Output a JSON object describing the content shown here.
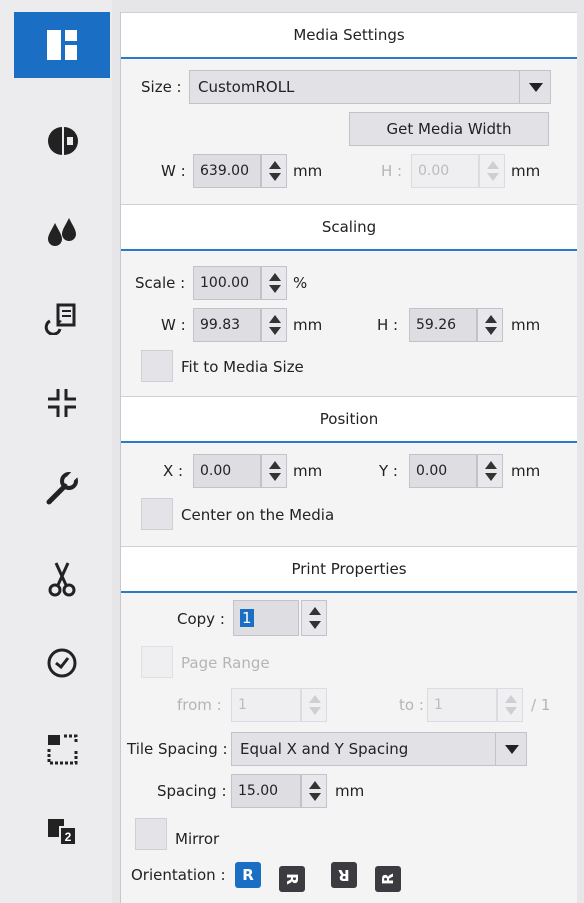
{
  "sidebar": {
    "items": [
      {
        "icon": "layout-icon",
        "active": true
      },
      {
        "icon": "color-half-icon",
        "active": false
      },
      {
        "icon": "ink-drops-icon",
        "active": false
      },
      {
        "icon": "color-sync-icon",
        "active": false
      },
      {
        "icon": "crop-marks-icon",
        "active": false
      },
      {
        "icon": "wrench-icon",
        "active": false
      },
      {
        "icon": "scissors-icon",
        "active": false
      },
      {
        "icon": "clock-icon",
        "active": false
      },
      {
        "icon": "frame-select-icon",
        "active": false
      },
      {
        "icon": "page-order-icon",
        "active": false
      }
    ],
    "accent": "#1a6fc4"
  },
  "media_settings": {
    "title": "Media Settings",
    "size_label": "Size :",
    "size_value": "CustomROLL",
    "get_width_button": "Get Media Width",
    "w_label": "W :",
    "w_value": "639.00",
    "w_unit": "mm",
    "h_label": "H :",
    "h_value": "0.00",
    "h_unit": "mm"
  },
  "scaling": {
    "title": "Scaling",
    "scale_label": "Scale :",
    "scale_value": "100.00",
    "scale_unit": "%",
    "w_label": "W :",
    "w_value": "99.83",
    "w_unit": "mm",
    "h_label": "H :",
    "h_value": "59.26",
    "h_unit": "mm",
    "fit_label": "Fit to Media Size"
  },
  "position": {
    "title": "Position",
    "x_label": "X :",
    "x_value": "0.00",
    "x_unit": "mm",
    "y_label": "Y :",
    "y_value": "0.00",
    "y_unit": "mm",
    "center_label": "Center on the Media"
  },
  "print_properties": {
    "title": "Print Properties",
    "copy_label": "Copy :",
    "copy_value": "1",
    "page_range_label": "Page Range",
    "from_label": "from :",
    "from_value": "1",
    "to_label": "to :",
    "to_value": "1",
    "total_pages": "/ 1",
    "tile_spacing_label": "Tile Spacing :",
    "tile_spacing_value": "Equal X and Y Spacing",
    "spacing_label": "Spacing :",
    "spacing_value": "15.00",
    "spacing_unit": "mm",
    "mirror_label": "Mirror",
    "orientation_label": "Orientation :",
    "orientations": [
      "R",
      "R",
      "R",
      "R"
    ]
  }
}
